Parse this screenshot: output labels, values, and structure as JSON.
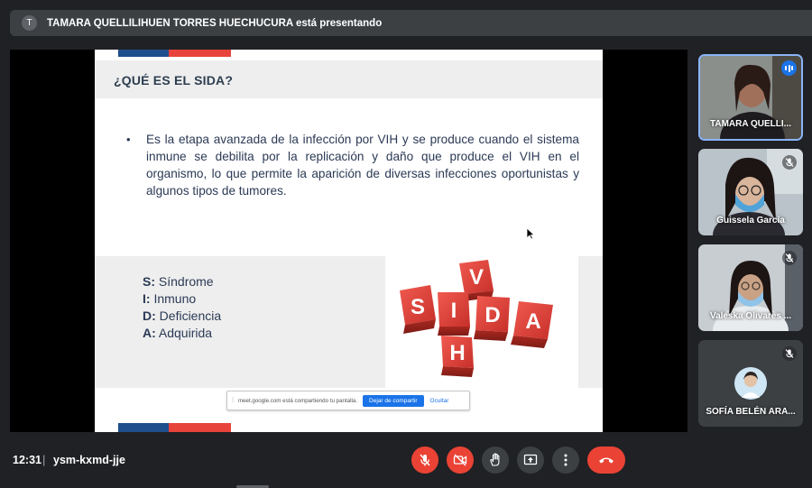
{
  "banner": {
    "avatar_letter": "T",
    "text": "TAMARA QUELLILIHUEN TORRES HUECHUCURA está presentando"
  },
  "slide": {
    "title": "¿QUÉ ES EL SIDA?",
    "bullet": "•",
    "body": "Es la etapa avanzada de la infección por VIH y se produce cuando el sistema inmune se debilita por la replicación y daño que produce el VIH en el organismo, lo que permite la aparición de diversas infecciones oportunistas y algunos tipos de tumores.",
    "acronym": [
      {
        "letter": "S:",
        "word": " Síndrome"
      },
      {
        "letter": "I:",
        "word": " Inmuno"
      },
      {
        "letter": "D:",
        "word": " Deficiencia"
      },
      {
        "letter": "A:",
        "word": " Adquirida"
      }
    ],
    "image_letters": {
      "row": [
        "S",
        "I",
        "D",
        "A"
      ],
      "top": "V",
      "bottom": "H"
    },
    "colors": {
      "cube": "#d63a31",
      "title": "#2d3e50",
      "accent_blue": "#1f4e8c",
      "accent_red": "#e8433a"
    }
  },
  "share_bar": {
    "message": "meet.google.com está compartiendo tu pantalla.",
    "stop_label": "Dejar de compartir",
    "hide_label": "Ocultar"
  },
  "participants": [
    {
      "name": "TAMARA QUELLI...",
      "speaking": true
    },
    {
      "name": "Guissela García",
      "muted": true
    },
    {
      "name": "Valeska Olivares ...",
      "muted": true
    },
    {
      "name": "SOFÍA BELÉN ARA...",
      "muted": true
    }
  ],
  "bottom_bar": {
    "time": "12:31",
    "separator": "|",
    "meeting_code": "ysm-kxmd-jje"
  }
}
